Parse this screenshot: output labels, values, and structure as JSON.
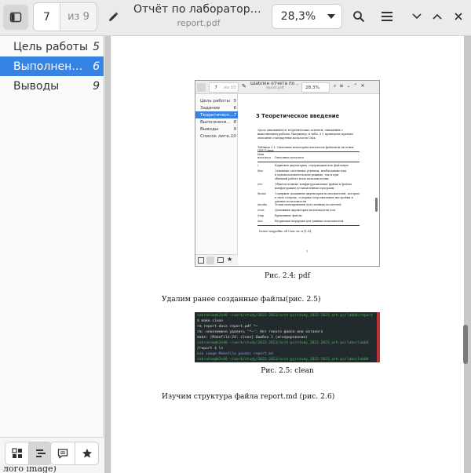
{
  "header": {
    "page_current": "7",
    "page_total": "из 9",
    "title": "Отчёт по лабораторной работе",
    "subtitle": "report.pdf",
    "zoom": "28,3%"
  },
  "sidebar": {
    "items": [
      {
        "label": "Цель работы",
        "page": "5"
      },
      {
        "label": "Выполнение лабораторной работы",
        "page": "6"
      },
      {
        "label": "Выводы",
        "page": "9"
      }
    ],
    "active_index": 1,
    "accent": "#3584e4"
  },
  "document": {
    "figure1": {
      "mini_header": {
        "page_current": "7",
        "page_total": "из 10",
        "title": "Шаблон отчёта по ...",
        "subtitle": "report.pdf",
        "zoom": "28,3%"
      },
      "mini_toc": [
        {
          "label": "Цель работы",
          "page": "5"
        },
        {
          "label": "Задание",
          "page": "6"
        },
        {
          "label": "Теоретическ...",
          "page": "7"
        },
        {
          "label": "Выполнени...",
          "page": "8"
        },
        {
          "label": "Выводы",
          "page": "9"
        },
        {
          "label": "Список лите...",
          "page": "10"
        }
      ],
      "mini_page": {
        "heading": "3  Теоретическое введение",
        "para1": "Здесь описываются теоретические аспекты, связанные с выполнением работы.",
        "para2": "Например, в табл. 3.1 приведено краткое описание стандартных каталогов Unix.",
        "table_title": "Таблица 3.1: Описание некоторых каталогов файловой системы GNU Linux",
        "col1": "Имя каталога",
        "col2": "Описание каталога",
        "rows": [
          {
            "name": "/",
            "desc": "Корневая директория, содержащая всю файловую"
          },
          {
            "name": "/bin",
            "desc": "Основные системные утилиты, необходимые как в однопользовательском режиме, так и при обычной работе всем пользователям"
          },
          {
            "name": "/etc",
            "desc": "Общесистемные конфигурационные файлы и файлы конфигурации установленных программ"
          },
          {
            "name": "/home",
            "desc": "Содержит домашние директории пользователей, которые, в свою очередь, содержат персональные настройки и данные пользователя"
          },
          {
            "name": "/media",
            "desc": "Точки монтирования для сменных носителей"
          },
          {
            "name": "/root",
            "desc": "Домашняя директория пользователя root"
          },
          {
            "name": "/tmp",
            "desc": "Временные файлы"
          },
          {
            "name": "/usr",
            "desc": "Вторичная иерархия для данных пользователя"
          }
        ],
        "footer": "Более подробно об Unix см. в [1–4].",
        "page_num": "7"
      },
      "caption": "Рис. 2.4: pdf"
    },
    "text1": "Удалим ранее созданные файлы(рис. 2.5)",
    "figure2": {
      "lines": [
        {
          "text": "iebrahim@k2e40 ~/work/study/2022-2023/arch-pc/study_2022-2023_arh-pc/lab04/report",
          "color": "#4fb35a"
        },
        {
          "text": "$ make clean",
          "color": "#d8d8d8"
        },
        {
          "text": "rm  report.docx  report.pdf *~",
          "color": "#d8d8d8"
        },
        {
          "text": "rm: невозможно удалить '*~': Нет такого файла или каталога",
          "color": "#d8d8d8"
        },
        {
          "text": "make: [Makefile:24: clean] Ошибка 1 (игнорирование)",
          "color": "#d8d8d8"
        },
        {
          "text": "iebrahim@k2e40 ~/work/study/2022-2023/arch-pc/study_2022-2023_arh-pc/labs/lab04",
          "color": "#4fb35a"
        },
        {
          "text": "/report $ ls",
          "color": "#d8d8d8"
        },
        {
          "text": "bib  image  Makefile  pandoc  report.md",
          "color": "#6aa6e8"
        },
        {
          "text": "iebrahim@k2e40 ~/work/study/2022-2023/arch-pc/study_2022-2023_arh-pc/labs/lab04",
          "color": "#4fb35a"
        }
      ],
      "caption": "Рис. 2.5: clean"
    },
    "text2": "Изучим структура файла report.md (рис. 2.6)",
    "overflow_text": "лого image)"
  }
}
